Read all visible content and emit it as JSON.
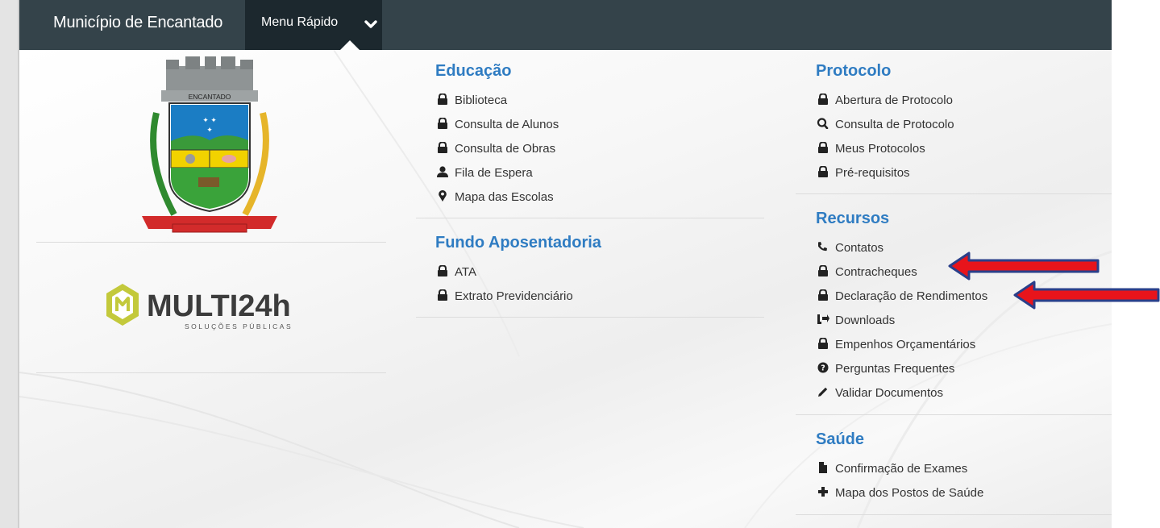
{
  "topbar": {
    "brand": "Município de Encantado",
    "menu_label": "Menu Rápido"
  },
  "branding": {
    "coat_of_arms_text": "ENCANTADO",
    "logo_main": "MULTI24h",
    "logo_sub": "SOLUÇÕES PÚBLICAS"
  },
  "sections": {
    "educacao": {
      "title": "Educação",
      "items": [
        {
          "label": "Biblioteca",
          "icon": "lock-icon"
        },
        {
          "label": "Consulta de Alunos",
          "icon": "lock-icon"
        },
        {
          "label": "Consulta de Obras",
          "icon": "lock-icon"
        },
        {
          "label": "Fila de Espera",
          "icon": "user-icon"
        },
        {
          "label": "Mapa das Escolas",
          "icon": "map-marker-icon"
        }
      ]
    },
    "fundo": {
      "title": "Fundo Aposentadoria",
      "items": [
        {
          "label": "ATA",
          "icon": "lock-icon"
        },
        {
          "label": "Extrato Previdenciário",
          "icon": "lock-icon"
        }
      ]
    },
    "protocolo": {
      "title": "Protocolo",
      "items": [
        {
          "label": "Abertura de Protocolo",
          "icon": "lock-icon"
        },
        {
          "label": "Consulta de Protocolo",
          "icon": "search-icon"
        },
        {
          "label": "Meus Protocolos",
          "icon": "lock-icon"
        },
        {
          "label": "Pré-requisitos",
          "icon": "lock-icon"
        }
      ]
    },
    "recursos": {
      "title": "Recursos",
      "items": [
        {
          "label": "Contatos",
          "icon": "phone-icon"
        },
        {
          "label": "Contracheques",
          "icon": "lock-icon"
        },
        {
          "label": "Declaração de Rendimentos",
          "icon": "lock-icon"
        },
        {
          "label": "Downloads",
          "icon": "download-icon"
        },
        {
          "label": "Empenhos Orçamentários",
          "icon": "lock-icon"
        },
        {
          "label": "Perguntas Frequentes",
          "icon": "question-circle-icon"
        },
        {
          "label": "Validar Documentos",
          "icon": "pencil-icon"
        }
      ]
    },
    "saude": {
      "title": "Saúde",
      "items": [
        {
          "label": "Confirmação de Exames",
          "icon": "file-icon"
        },
        {
          "label": "Mapa dos Postos de Saúde",
          "icon": "plus-icon"
        }
      ]
    }
  },
  "colors": {
    "topbar": "#34434a",
    "menu_button": "#1c282e",
    "section_title": "#2f7cc2",
    "annotation_arrow": "#e8141b"
  }
}
